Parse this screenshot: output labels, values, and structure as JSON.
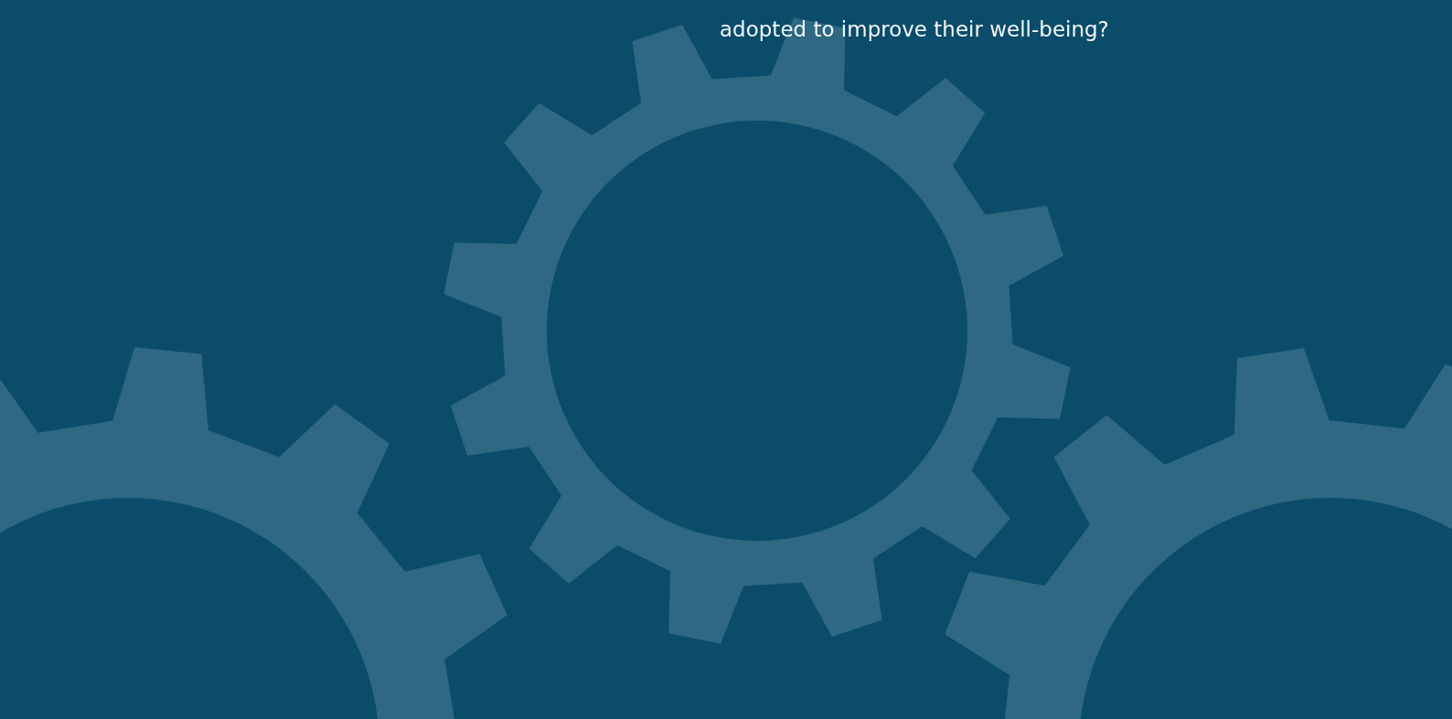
{
  "paragraph": "adopted to improve their well-being?"
}
